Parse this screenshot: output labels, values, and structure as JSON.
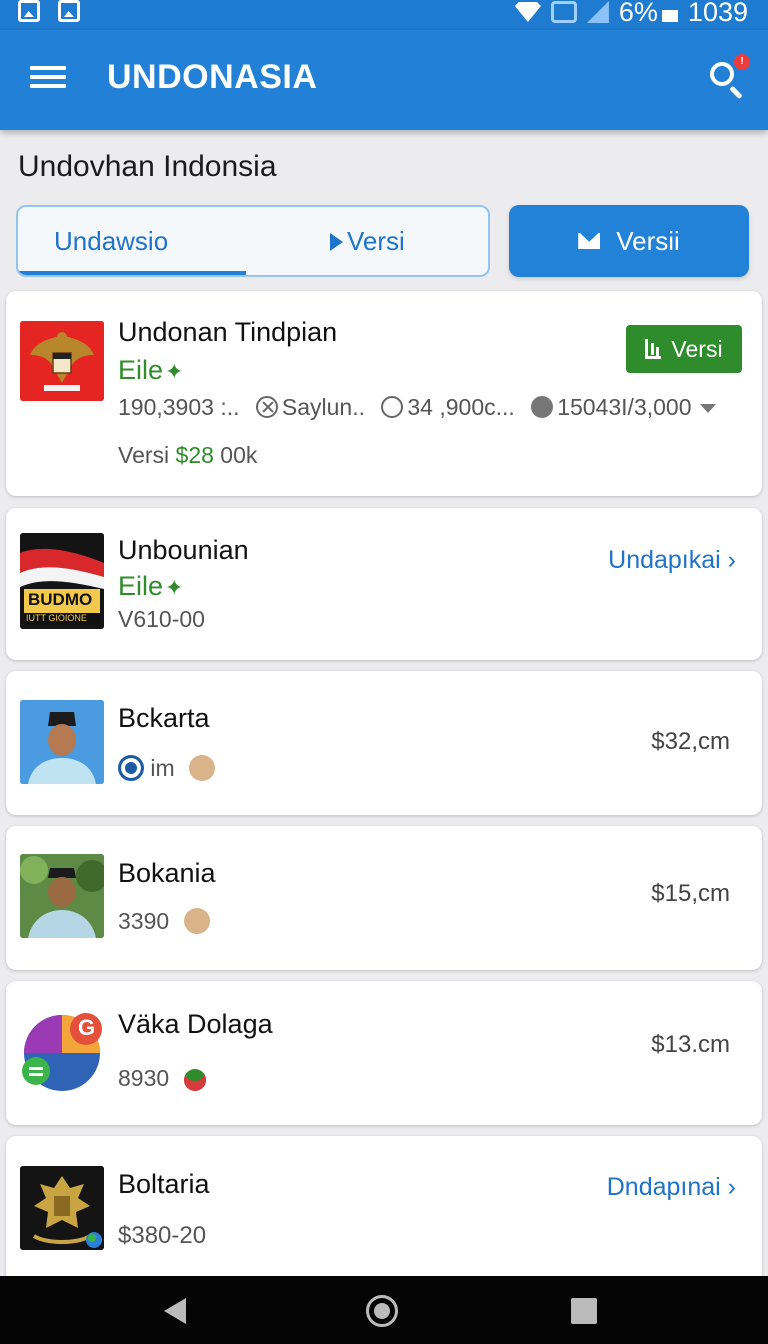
{
  "status_bar": {
    "battery": "6%",
    "time": "1039"
  },
  "app_bar": {
    "title": "UNDONASIA",
    "notification_count": "!"
  },
  "section_title": "Undovhan Indonsia",
  "tabs": [
    {
      "label": "Undawsio",
      "selected": true
    },
    {
      "label": "Versi"
    },
    {
      "label": "Versii",
      "style": "primary"
    }
  ],
  "cards": [
    {
      "title": "Undonan Tindpian",
      "subtitle": "Eile",
      "button_label": "Versi",
      "stats": [
        "190,3903 :..",
        "Saylun..",
        "34 ,900c...",
        "15043I/3,000"
      ],
      "footer_prefix": "Versi",
      "footer_price": "$28",
      "footer_suffix": "00k",
      "thumb_icon": "garuda-emblem-icon"
    },
    {
      "title": "Unbounian",
      "subtitle": "Eile",
      "meta": "V610-00",
      "link": "Undapıkai",
      "thumb_text": "BUDMO",
      "thumb_subtext": "IUTT GIOIONE"
    },
    {
      "title": "Bckarta",
      "meta": "im",
      "price": "$32,cm",
      "thumb_icon": "person-photo-icon"
    },
    {
      "title": "Bokania",
      "meta": "3390",
      "price": "$15,cm",
      "thumb_icon": "person-photo-icon"
    },
    {
      "title": "Väka Dolaga",
      "meta": "8930",
      "price": "$13.cm",
      "thumb_icon": "colorful-logo-icon",
      "thumb_letter": "G"
    },
    {
      "title": "Boltaria",
      "meta": "$380-20",
      "link": "Dndapınai",
      "thumb_icon": "gold-crest-icon"
    }
  ],
  "colors": {
    "primary": "#2281d6",
    "green": "#2e8c2c",
    "link": "#1f73c8"
  }
}
